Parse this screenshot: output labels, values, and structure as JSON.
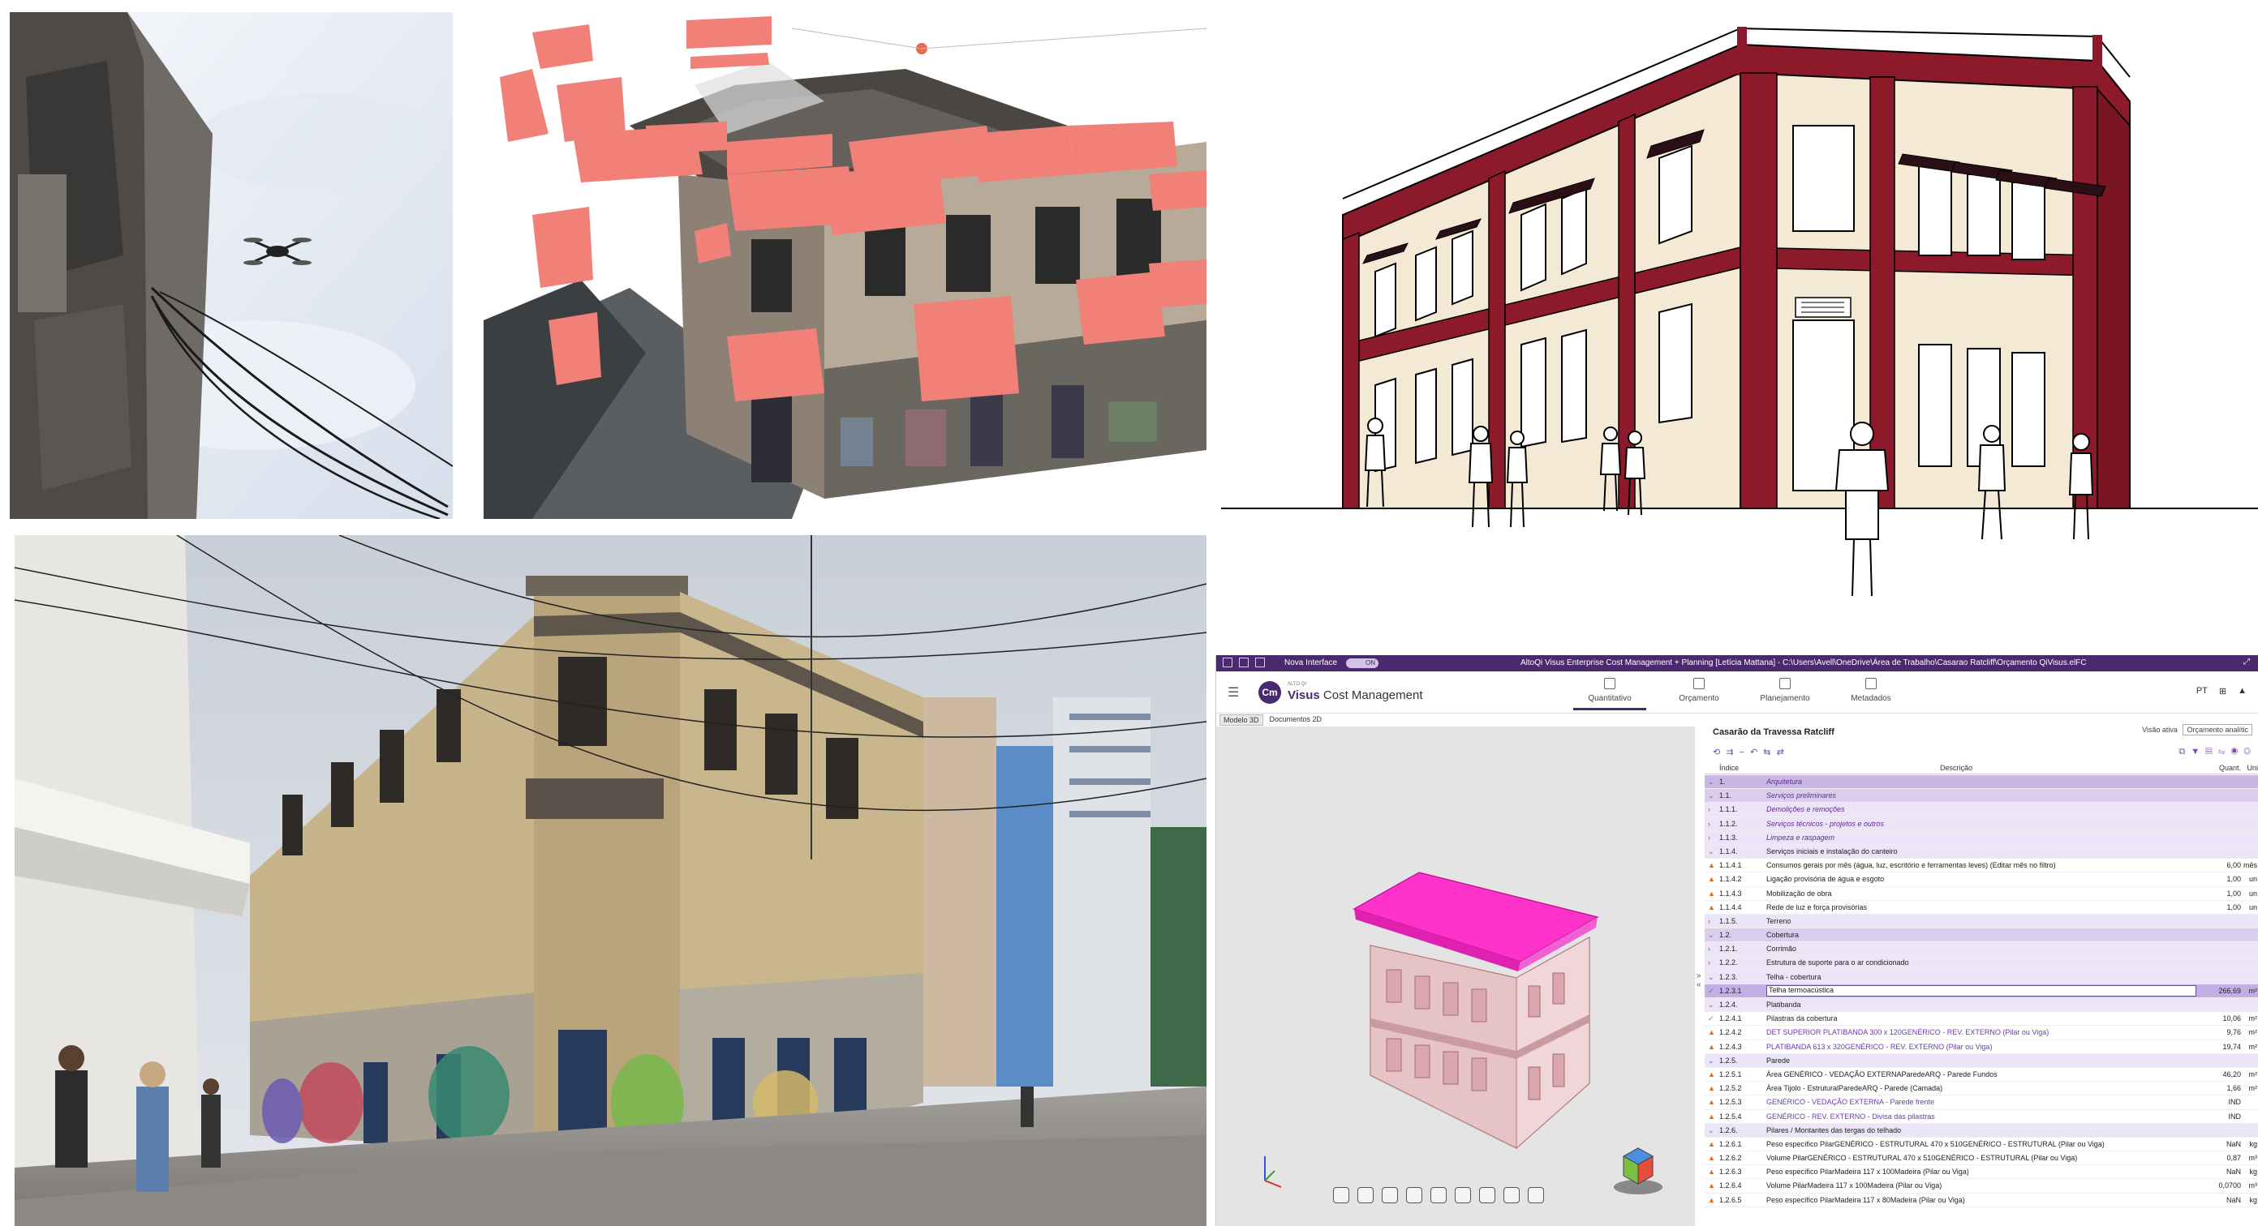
{
  "colors": {
    "brand": "#4a2a6e",
    "facade_trim": "#8c1a2b",
    "facade_wall": "#f3e9d4",
    "roof_highlight": "#ff33cc",
    "camera_planes": "#f08078"
  },
  "app": {
    "title_bar": {
      "nova_label": "Nova Interface",
      "toggle_label": "ON",
      "path": "AltoQi Visus Enterprise Cost Management + Planning [Letícia Mattana] - C:\\Users\\Avell\\OneDrive\\Área de Trabalho\\Casarao Ratcliff\\Orçamento QiVisus.elFC"
    },
    "logo": {
      "badge": "Cm",
      "small": "ALTO QI",
      "brand": "Visus",
      "product": "Cost Management"
    },
    "tabs": [
      {
        "label": "Quantitativo",
        "icon": "clipboard-icon"
      },
      {
        "label": "Orçamento",
        "icon": "money-icon"
      },
      {
        "label": "Planejamento",
        "icon": "document-icon"
      },
      {
        "label": "Metadados",
        "icon": "chart-icon"
      }
    ],
    "language": "PT",
    "view_tabs": [
      "Modelo 3D",
      "Documentos 2D"
    ],
    "project_title": "Casarão da Travessa Ratcliff",
    "visao_label": "Visão ativa",
    "visao_value": "Orçamento analític",
    "columns": {
      "index": "Índice",
      "desc": "Descrição",
      "qty": "Quant.",
      "unit": "Unid"
    },
    "rows": [
      {
        "idx": "1.",
        "desc": "Arquitetura",
        "qty": "",
        "un": "",
        "style": "lvl1 italic",
        "mk": "⌄"
      },
      {
        "idx": "1.1.",
        "desc": "Serviços preliminares",
        "qty": "",
        "un": "",
        "style": "lvl2 italic",
        "mk": "⌄"
      },
      {
        "idx": "1.1.1.",
        "desc": "Demolições e remoções",
        "qty": "",
        "un": "",
        "style": "lvl3 italic",
        "mk": "›"
      },
      {
        "idx": "1.1.2.",
        "desc": "Serviços técnicos - projetos e outros",
        "qty": "",
        "un": "",
        "style": "lvl3 italic",
        "mk": "›"
      },
      {
        "idx": "1.1.3.",
        "desc": "Limpeza e raspagem",
        "qty": "",
        "un": "",
        "style": "lvl3 italic",
        "mk": "›"
      },
      {
        "idx": "1.1.4.",
        "desc": "Serviços iniciais e instalação do canteiro",
        "qty": "",
        "un": "",
        "style": "lvl3",
        "mk": "⌄"
      },
      {
        "idx": "1.1.4.1",
        "desc": "Consumos gerais por mês (água, luz, escritório e ferramentas leves) (Editar mês no filtro)",
        "qty": "6,00",
        "un": "mês",
        "style": "",
        "mk": "▲"
      },
      {
        "idx": "1.1.4.2",
        "desc": "Ligação provisória de água e esgoto",
        "qty": "1,00",
        "un": "un",
        "style": "",
        "mk": "▲"
      },
      {
        "idx": "1.1.4.3",
        "desc": "Mobilização de obra",
        "qty": "1,00",
        "un": "un",
        "style": "",
        "mk": "▲"
      },
      {
        "idx": "1.1.4.4",
        "desc": "Rede de luz e força provisórias",
        "qty": "1,00",
        "un": "un",
        "style": "",
        "mk": "▲"
      },
      {
        "idx": "1.1.5.",
        "desc": "Terreno",
        "qty": "",
        "un": "",
        "style": "lvl3",
        "mk": "›"
      },
      {
        "idx": "1.2.",
        "desc": "Cobertura",
        "qty": "",
        "un": "",
        "style": "lvl2",
        "mk": "⌄"
      },
      {
        "idx": "1.2.1.",
        "desc": "Corrimão",
        "qty": "",
        "un": "",
        "style": "lvl3",
        "mk": "›"
      },
      {
        "idx": "1.2.2.",
        "desc": "Estrutura de suporte para o ar condicionado",
        "qty": "",
        "un": "",
        "style": "lvl3",
        "mk": "›"
      },
      {
        "idx": "1.2.3.",
        "desc": "Telha - cobertura",
        "qty": "",
        "un": "",
        "style": "lvl3",
        "mk": "⌄"
      },
      {
        "idx": "1.2.3.1",
        "desc": "Telha termoacústica",
        "qty": "266,69",
        "un": "m²",
        "style": "sel",
        "mk": "✓"
      },
      {
        "idx": "1.2.4.",
        "desc": "Platibanda",
        "qty": "",
        "un": "",
        "style": "lvl3",
        "mk": "⌄"
      },
      {
        "idx": "1.2.4.1",
        "desc": "Pilastras da cobertura",
        "qty": "10,06",
        "un": "m²",
        "style": "",
        "mk": "✓"
      },
      {
        "idx": "1.2.4.2",
        "desc": "DET SUPERIOR PLATIBANDA 300 x 120GENÉRICO - REV. EXTERNO (Pilar ou Viga)",
        "qty": "9,76",
        "un": "m²",
        "style": "link",
        "mk": "▲"
      },
      {
        "idx": "1.2.4.3",
        "desc": "PLATIBANDA 613 x 320GENÉRICO - REV. EXTERNO (Pilar ou Viga)",
        "qty": "19,74",
        "un": "m²",
        "style": "link",
        "mk": "▲"
      },
      {
        "idx": "1.2.5.",
        "desc": "Parede",
        "qty": "",
        "un": "",
        "style": "lvl3",
        "mk": "⌄"
      },
      {
        "idx": "1.2.5.1",
        "desc": "Área GENÉRICO - VEDAÇÃO EXTERNAParedeARQ - Parede Fundos",
        "qty": "46,20",
        "un": "m²",
        "style": "",
        "mk": "▲"
      },
      {
        "idx": "1.2.5.2",
        "desc": "Área Tijolo - EstruturalParedeARQ - Parede (Camada)",
        "qty": "1,66",
        "un": "m²",
        "style": "",
        "mk": "▲"
      },
      {
        "idx": "1.2.5.3",
        "desc": "GENÉRICO - VEDAÇÃO EXTERNA - Parede frente",
        "qty": "IND",
        "un": "",
        "style": "link",
        "mk": "▲"
      },
      {
        "idx": "1.2.5.4",
        "desc": "GENÉRICO - REV. EXTERNO - Divisa das pilastras",
        "qty": "IND",
        "un": "",
        "style": "link",
        "mk": "▲"
      },
      {
        "idx": "1.2.6.",
        "desc": "Pilares / Montantes das tergas do telhado",
        "qty": "",
        "un": "",
        "style": "lvl3",
        "mk": "⌄"
      },
      {
        "idx": "1.2.6.1",
        "desc": "Peso específico PilarGENÉRICO - ESTRUTURAL 470 x 510GENÉRICO - ESTRUTURAL (Pilar ou Viga)",
        "qty": "NaN",
        "un": "kg",
        "style": "",
        "mk": "▲"
      },
      {
        "idx": "1.2.6.2",
        "desc": "Volume PilarGENÉRICO - ESTRUTURAL 470 x 510GENÉRICO - ESTRUTURAL (Pilar ou Viga)",
        "qty": "0,87",
        "un": "m³",
        "style": "",
        "mk": "▲"
      },
      {
        "idx": "1.2.6.3",
        "desc": "Peso específico PilarMadeira 117 x 100Madeira (Pilar ou Viga)",
        "qty": "NaN",
        "un": "kg",
        "style": "",
        "mk": "▲"
      },
      {
        "idx": "1.2.6.4",
        "desc": "Volume PilarMadeira 117 x 100Madeira (Pilar ou Viga)",
        "qty": "0,0700",
        "un": "m³",
        "style": "",
        "mk": "▲"
      },
      {
        "idx": "1.2.6.5",
        "desc": "Peso específico PilarMadeira 117 x 80Madeira (Pilar ou Viga)",
        "qty": "NaN",
        "un": "kg",
        "style": "",
        "mk": "▲"
      }
    ]
  }
}
